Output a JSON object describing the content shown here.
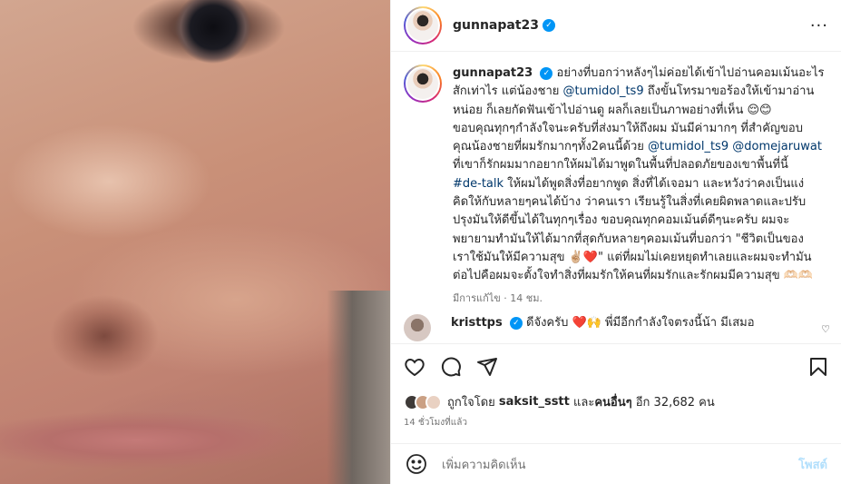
{
  "post": {
    "username": "gunnapat23",
    "more_label": "···",
    "caption_lines": [
      "อย่างที่บอกว่าหลังๆไม่ค่อยได้เข้าไปอ่านคอมเม้นอะไร",
      "สักเท่าไร แต่น้องชาย @tumidol_ts9 ถึงขั้นโทรมาขอร้องให้เข้ามาอ่าน",
      "หน่อย ก็เลยกัดฟันเข้าไปอ่านดู ผลก็เลยเป็นภาพอย่างที่เห็น 😌😊",
      "ขอบคุณทุกๆกำลังใจนะครับที่ส่งมาให้ถึงผม มันมีค่ามากๆ ที่สำคัญขอบ",
      "คุณน้องชายที่ผมรักมากๆทั้ง2คนนี้ด้วย @tumidol_ts9 @domejaruwat",
      "ที่เขาก็รักผมมากอยากให้ผมได้มาพูดในพื้นที่ปลอดภัยของเขาพื้นที่นี้",
      "#de-talk ให้ผมได้พูดสิ่งที่อยากพูด สิ่งที่ได้เจอมา และหวังว่าคงเป็นแง่",
      "คิดให้กับหลายๆคนได้บ้าง ว่าคนเรา เรียนรู้ในสิ่งที่เคยผิดพลาดและปรับ",
      "ปรุงมันให้ดีขึ้นได้ในทุกๆเรื่อง ขอบคุณทุกคอมเม้นต์ดีๆนะครับ ผมจะ",
      "พยายามทำมันให้ได้มากที่สุดกับหลายๆคอมเม้นที่บอกว่า \"ชีวิตเป็นของ",
      "เราใช้มันให้มีความสุข ✌🏼❤️\" แต่ที่ผมไม่เคยหยุดทำเลยและผมจะทำมัน",
      "ต่อไปคือผมจะตั้งใจทำสิ่งที่ผมรักให้คนที่ผมรักและรักผมมีความสุข 🫶🏻🫶🏻"
    ],
    "caption_meta": "มีการแก้ไข · 14 ชม."
  },
  "comment": {
    "username": "kristtps",
    "text": "ดีจังครับ ❤️🙌 พี่มีอีกกำลังใจตรงนี้น้า มีเสมอ"
  },
  "likes": {
    "prefix": "ถูกใจโดย",
    "user": "saksit_sstt",
    "middle": "และ",
    "others": "คนอื่นๆ",
    "suffix": "อีก 32,682 คน"
  },
  "timestamp": "14 ชั่วโมงที่แล้ว",
  "add_comment": {
    "placeholder": "เพิ่มความคิดเห็น",
    "post_label": "โพสต์"
  },
  "icons": [
    "heart-icon",
    "comment-icon",
    "share-icon",
    "bookmark-icon",
    "emoji-icon",
    "verified-icon",
    "more-icon"
  ]
}
